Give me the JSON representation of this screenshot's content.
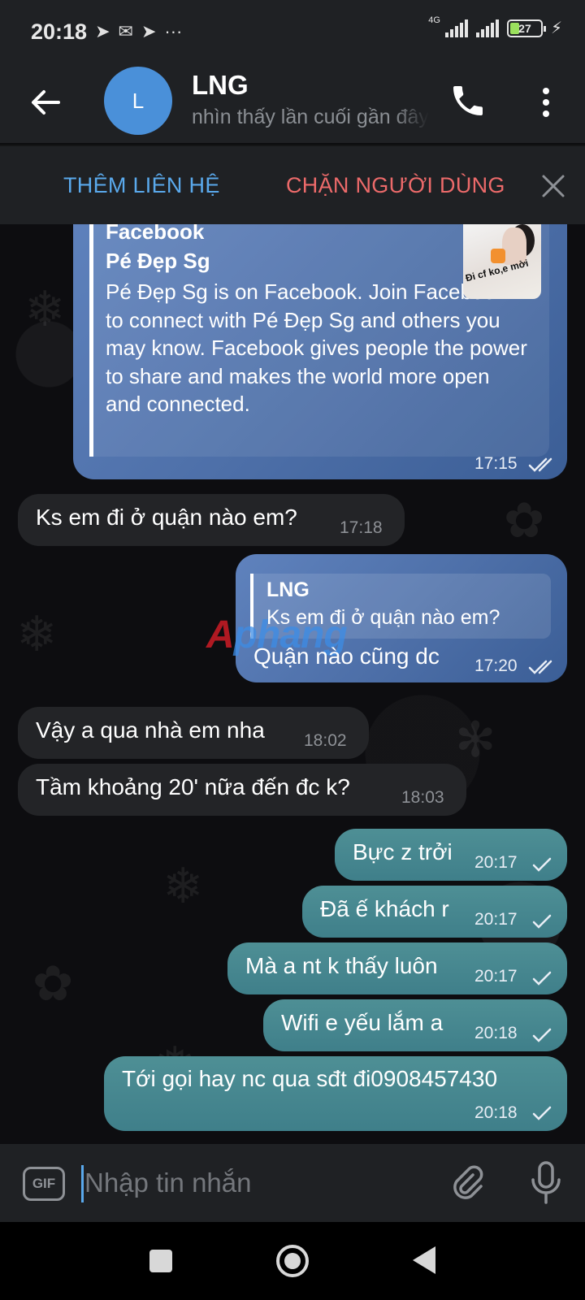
{
  "status_bar": {
    "time": "20:18",
    "network": "4G",
    "battery": "27",
    "more": "···"
  },
  "header": {
    "avatar_letter": "L",
    "contact_name": "LNG",
    "last_seen": "nhìn thấy lần cuối gần đây"
  },
  "action_bar": {
    "add_contact": "THÊM LIÊN HỆ",
    "block_user": "CHẶN NGƯỜI DÙNG"
  },
  "chat": {
    "link_preview": {
      "site": "Facebook",
      "title": "Pé Đẹp Sg",
      "description": "Pé Đẹp Sg is on Facebook. Join Facebook to connect with Pé Đẹp Sg and others you may know. Facebook gives people the power to share and makes the world more open and connected.",
      "thumb_caption": "Đi cf ko,e mời",
      "time": "17:15"
    },
    "messages": [
      {
        "text": "Ks em đi ở quận nào em?",
        "time": "17:18",
        "direction": "in"
      },
      {
        "reply_to_name": "LNG",
        "reply_to_text": "Ks em đi ở quận nào em?",
        "text": "Quận nào cũng dc",
        "time": "17:20",
        "direction": "out"
      },
      {
        "text": "Vậy a qua nhà em nha",
        "time": "18:02",
        "direction": "in"
      },
      {
        "text": "Tầm khoảng 20' nữa đến đc k?",
        "time": "18:03",
        "direction": "in"
      },
      {
        "text": "Bực z trởi",
        "time": "20:17",
        "direction": "out"
      },
      {
        "text": "Đã ế khách r",
        "time": "20:17",
        "direction": "out"
      },
      {
        "text": "Mà a nt k thấy luôn",
        "time": "20:17",
        "direction": "out"
      },
      {
        "text": "Wifi e yếu lắm a",
        "time": "20:18",
        "direction": "out"
      },
      {
        "text": "Tới gọi hay nc qua sđt đi0908457430",
        "time": "20:18",
        "direction": "out"
      }
    ],
    "watermark": {
      "part1": "A",
      "part2": "phang"
    }
  },
  "input": {
    "gif_label": "GIF",
    "placeholder": "Nhập tin nhắn"
  },
  "colors": {
    "accent_blue": "#5aa9ec",
    "danger_red": "#ec6a6a",
    "bar_bg": "#1f2124",
    "incoming_bubble": "#232427",
    "outgoing_teal": "#437f8a"
  }
}
